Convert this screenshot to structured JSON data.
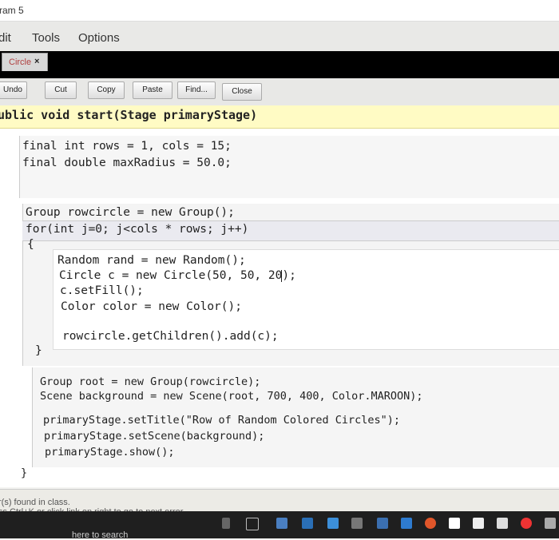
{
  "window": {
    "title": "ram 5"
  },
  "menu": {
    "items": [
      "dit",
      "Tools",
      "Options"
    ]
  },
  "tabs": [
    {
      "label": "Circle",
      "close": "×"
    }
  ],
  "toolbar": {
    "undo": "Undo",
    "cut": "Cut",
    "copy": "Copy",
    "paste": "Paste",
    "find": "Find...",
    "close": "Close"
  },
  "code": {
    "signature": "ublic void start(Stage primaryStage)",
    "line1": "final int rows = 1, cols = 15;",
    "line2": "final double maxRadius = 50.0;",
    "line3": "Group rowcircle = new Group();",
    "line4": "for(int j=0; j<cols * rows; j++)",
    "line5": "{",
    "line6": "Random rand = new Random();",
    "line7": "Circle c = new Circle(50, 50, 20);",
    "line8": "c.setFill();",
    "line9": "Color color = new Color();",
    "line10": "rowcircle.getChildren().add(c);",
    "line11": "}",
    "line12": "Group root = new Group(rowcircle);",
    "line13": "Scene background = new Scene(root, 700, 400, Color.MAROON);",
    "line14": "primaryStage.setTitle(\"Row of Random Colored Circles\");",
    "line15": "primaryStage.setScene(background);",
    "line16": "primaryStage.show();",
    "line17": "}"
  },
  "status": {
    "line1": "r(s) found in class.",
    "line2": "ss Ctrl+K or click link on right to go to next error."
  },
  "taskbar": {
    "search_hint": "here to search"
  },
  "colors": {
    "tab_bar": "#000000",
    "signature_bg": "#fffbc4",
    "taskbar": "#1f1f1f"
  }
}
